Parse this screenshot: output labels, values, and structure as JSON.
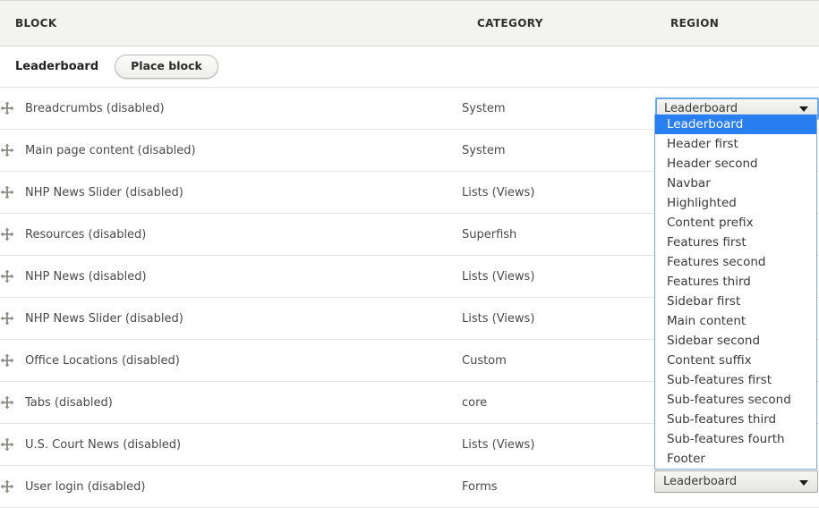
{
  "table": {
    "headers": {
      "block": "BLOCK",
      "category": "CATEGORY",
      "region": "REGION"
    },
    "region_group": {
      "title": "Leaderboard",
      "place_block_label": "Place block"
    },
    "rows": [
      {
        "drag_icon": "move-drag-icon",
        "block": "Breadcrumbs (disabled)",
        "category": "System"
      },
      {
        "drag_icon": "move-drag-icon",
        "block": "Main page content (disabled)",
        "category": "System"
      },
      {
        "drag_icon": "move-drag-icon",
        "block": "NHP News Slider (disabled)",
        "category": "Lists (Views)"
      },
      {
        "drag_icon": "move-drag-icon",
        "block": "Resources (disabled)",
        "category": "Superfish"
      },
      {
        "drag_icon": "move-drag-icon",
        "block": "NHP News (disabled)",
        "category": "Lists (Views)"
      },
      {
        "drag_icon": "move-drag-icon",
        "block": "NHP News Slider (disabled)",
        "category": "Lists (Views)"
      },
      {
        "drag_icon": "move-drag-icon",
        "block": "Office Locations (disabled)",
        "category": "Custom"
      },
      {
        "drag_icon": "move-drag-icon",
        "block": "Tabs (disabled)",
        "category": "core"
      },
      {
        "drag_icon": "move-drag-icon",
        "block": "U.S. Court News (disabled)",
        "category": "Lists (Views)"
      },
      {
        "drag_icon": "move-drag-icon",
        "block": "User login (disabled)",
        "category": "Forms"
      }
    ]
  },
  "region_select": {
    "open_value": "Leaderboard",
    "closed_value": "Leaderboard",
    "selected_option": "Leaderboard",
    "arrow_icon": "chevron-down-icon",
    "options": [
      "Leaderboard",
      "Header first",
      "Header second",
      "Navbar",
      "Highlighted",
      "Content prefix",
      "Features first",
      "Features second",
      "Features third",
      "Sidebar first",
      "Main content",
      "Sidebar second",
      "Content suffix",
      "Sub-features first",
      "Sub-features second",
      "Sub-features third",
      "Sub-features fourth",
      "Footer"
    ]
  },
  "colors": {
    "highlight_blue": "#2a7ff0",
    "focus_border_blue": "#6aa7e8",
    "header_bg": "#f3f3f1",
    "row_border": "#e6e6e3",
    "text": "#4a4a4a"
  }
}
